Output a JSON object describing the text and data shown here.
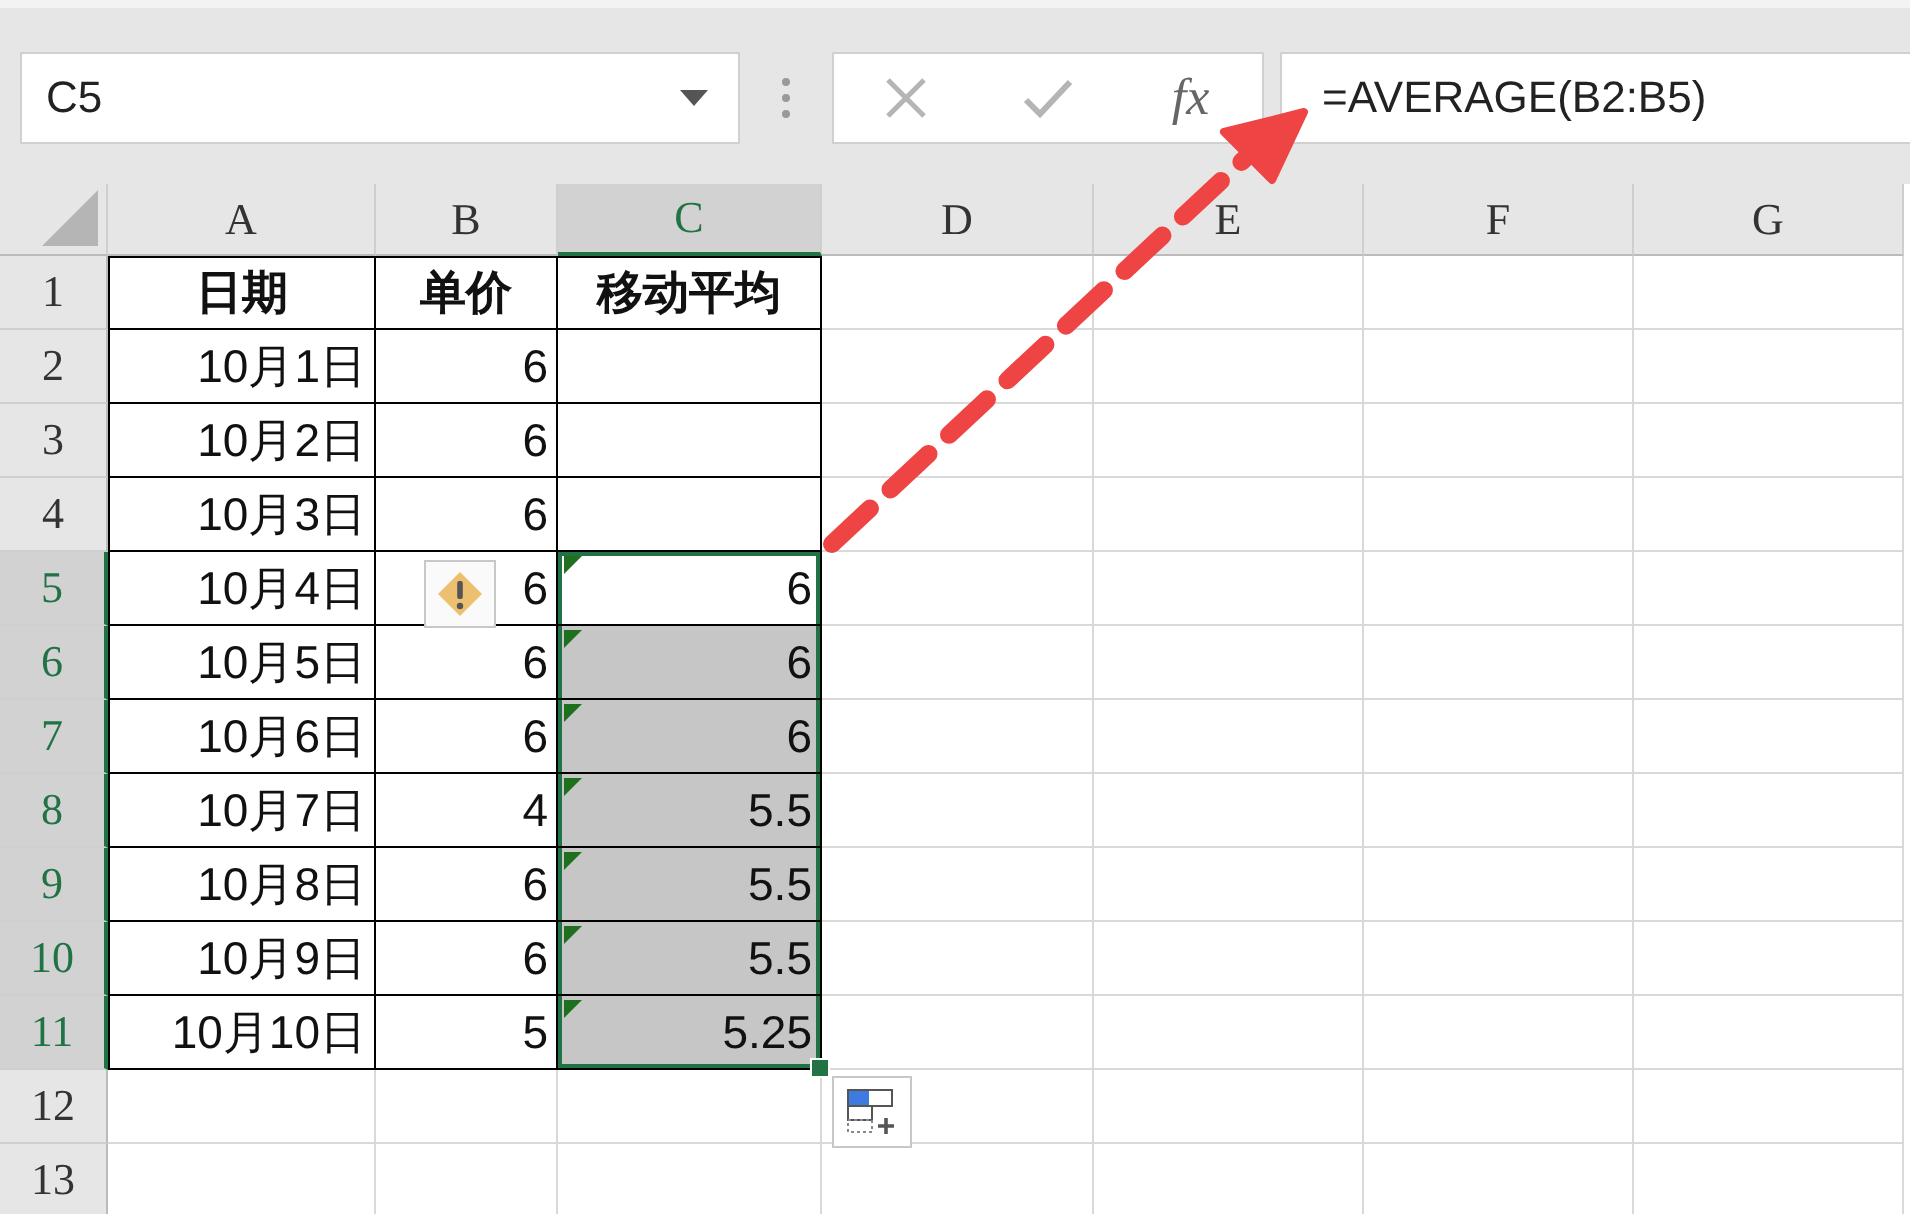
{
  "name_box": {
    "value": "C5"
  },
  "formula_buttons": {
    "fx_label": "fx"
  },
  "formula_bar": {
    "value": "=AVERAGE(B2:B5)"
  },
  "columns": [
    {
      "label": "A",
      "selected": false
    },
    {
      "label": "B",
      "selected": false
    },
    {
      "label": "C",
      "selected": true
    },
    {
      "label": "D",
      "selected": false
    },
    {
      "label": "E",
      "selected": false
    },
    {
      "label": "F",
      "selected": false
    },
    {
      "label": "G",
      "selected": false
    }
  ],
  "rows": [
    {
      "label": "1",
      "selected": false,
      "kind": "header",
      "cells": [
        {
          "text": "日期",
          "selected": false,
          "flag": false,
          "warning": false
        },
        {
          "text": "单价",
          "selected": false,
          "flag": false,
          "warning": false
        },
        {
          "text": "移动平均",
          "selected": false,
          "flag": false,
          "warning": false
        }
      ]
    },
    {
      "label": "2",
      "selected": false,
      "kind": "data",
      "cells": [
        {
          "text": "10月1日",
          "selected": false,
          "flag": false,
          "warning": false
        },
        {
          "text": "6",
          "selected": false,
          "flag": false,
          "warning": false
        },
        {
          "text": "",
          "selected": false,
          "flag": false,
          "warning": false
        }
      ]
    },
    {
      "label": "3",
      "selected": false,
      "kind": "data",
      "cells": [
        {
          "text": "10月2日",
          "selected": false,
          "flag": false,
          "warning": false
        },
        {
          "text": "6",
          "selected": false,
          "flag": false,
          "warning": false
        },
        {
          "text": "",
          "selected": false,
          "flag": false,
          "warning": false
        }
      ]
    },
    {
      "label": "4",
      "selected": false,
      "kind": "data",
      "cells": [
        {
          "text": "10月3日",
          "selected": false,
          "flag": false,
          "warning": false
        },
        {
          "text": "6",
          "selected": false,
          "flag": false,
          "warning": false
        },
        {
          "text": "",
          "selected": false,
          "flag": false,
          "warning": false
        }
      ]
    },
    {
      "label": "5",
      "selected": true,
      "kind": "data",
      "cells": [
        {
          "text": "10月4日",
          "selected": false,
          "flag": false,
          "warning": false
        },
        {
          "text": "6",
          "selected": false,
          "flag": false,
          "warning": true
        },
        {
          "text": "6",
          "selected": true,
          "active": true,
          "flag": true,
          "warning": false
        }
      ]
    },
    {
      "label": "6",
      "selected": true,
      "kind": "data",
      "cells": [
        {
          "text": "10月5日",
          "selected": false,
          "flag": false,
          "warning": false
        },
        {
          "text": "6",
          "selected": false,
          "flag": false,
          "warning": false
        },
        {
          "text": "6",
          "selected": true,
          "flag": true,
          "warning": false
        }
      ]
    },
    {
      "label": "7",
      "selected": true,
      "kind": "data",
      "cells": [
        {
          "text": "10月6日",
          "selected": false,
          "flag": false,
          "warning": false
        },
        {
          "text": "6",
          "selected": false,
          "flag": false,
          "warning": false
        },
        {
          "text": "6",
          "selected": true,
          "flag": true,
          "warning": false
        }
      ]
    },
    {
      "label": "8",
      "selected": true,
      "kind": "data",
      "cells": [
        {
          "text": "10月7日",
          "selected": false,
          "flag": false,
          "warning": false
        },
        {
          "text": "4",
          "selected": false,
          "flag": false,
          "warning": false
        },
        {
          "text": "5.5",
          "selected": true,
          "flag": true,
          "warning": false
        }
      ]
    },
    {
      "label": "9",
      "selected": true,
      "kind": "data",
      "cells": [
        {
          "text": "10月8日",
          "selected": false,
          "flag": false,
          "warning": false
        },
        {
          "text": "6",
          "selected": false,
          "flag": false,
          "warning": false
        },
        {
          "text": "5.5",
          "selected": true,
          "flag": true,
          "warning": false
        }
      ]
    },
    {
      "label": "10",
      "selected": true,
      "kind": "data",
      "cells": [
        {
          "text": "10月9日",
          "selected": false,
          "flag": false,
          "warning": false
        },
        {
          "text": "6",
          "selected": false,
          "flag": false,
          "warning": false
        },
        {
          "text": "5.5",
          "selected": true,
          "flag": true,
          "warning": false
        }
      ]
    },
    {
      "label": "11",
      "selected": true,
      "kind": "data",
      "cells": [
        {
          "text": "10月10日",
          "selected": false,
          "flag": false,
          "warning": false
        },
        {
          "text": "5",
          "selected": false,
          "flag": false,
          "warning": false
        },
        {
          "text": "5.25",
          "selected": true,
          "flag": true,
          "warning": false
        }
      ]
    },
    {
      "label": "12",
      "selected": false,
      "cells": []
    },
    {
      "label": "13",
      "selected": false,
      "cells": []
    }
  ]
}
